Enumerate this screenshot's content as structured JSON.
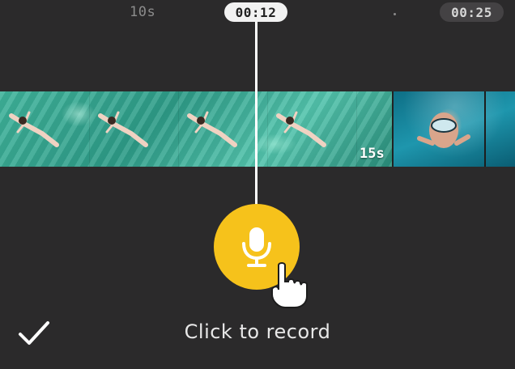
{
  "ruler": {
    "tick_label": "10s",
    "current_time": "00:12",
    "end_time": "00:25"
  },
  "clips": [
    {
      "name": "floating-swimmer-clip",
      "duration_label": "15s"
    },
    {
      "name": "snorkel-diver-clip"
    }
  ],
  "record": {
    "button_icon": "microphone-icon",
    "cursor_icon": "hand-pointer-icon",
    "hint": "Click to record"
  },
  "toolbar": {
    "confirm_icon": "checkmark-icon"
  },
  "colors": {
    "background": "#2b2a2b",
    "record_accent": "#f6c21b",
    "playhead": "#ffffff"
  }
}
